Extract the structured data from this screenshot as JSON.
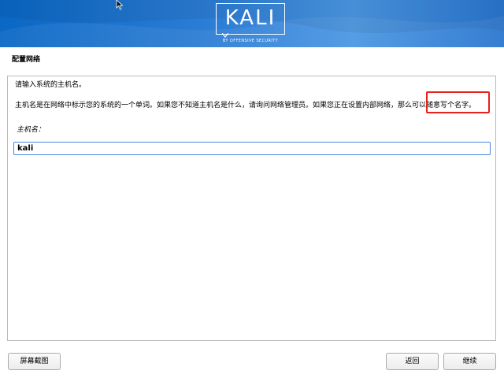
{
  "banner": {
    "logo_text": "KALI",
    "logo_subtext": "BY OFFENSIVE SECURITY",
    "colors": {
      "gradient_start": "#0a67c4",
      "gradient_end": "#4b97e3"
    }
  },
  "header": {
    "title": "配置网络"
  },
  "main": {
    "prompt": "请输入系统的主机名。",
    "description": "主机名是在网络中标示您的系统的一个单词。如果您不知道主机名是什么，请询问网络管理员。如果您正在设置内部网络，那么可以随意写个名字。",
    "field_label": "主机名：",
    "hostname_value": "kali",
    "highlight_color": "#e8201b"
  },
  "buttons": {
    "screenshot_label": "屏幕截图",
    "back_label": "返回",
    "continue_label": "继续"
  },
  "icons": {
    "cursor": "mouse-pointer-icon"
  }
}
